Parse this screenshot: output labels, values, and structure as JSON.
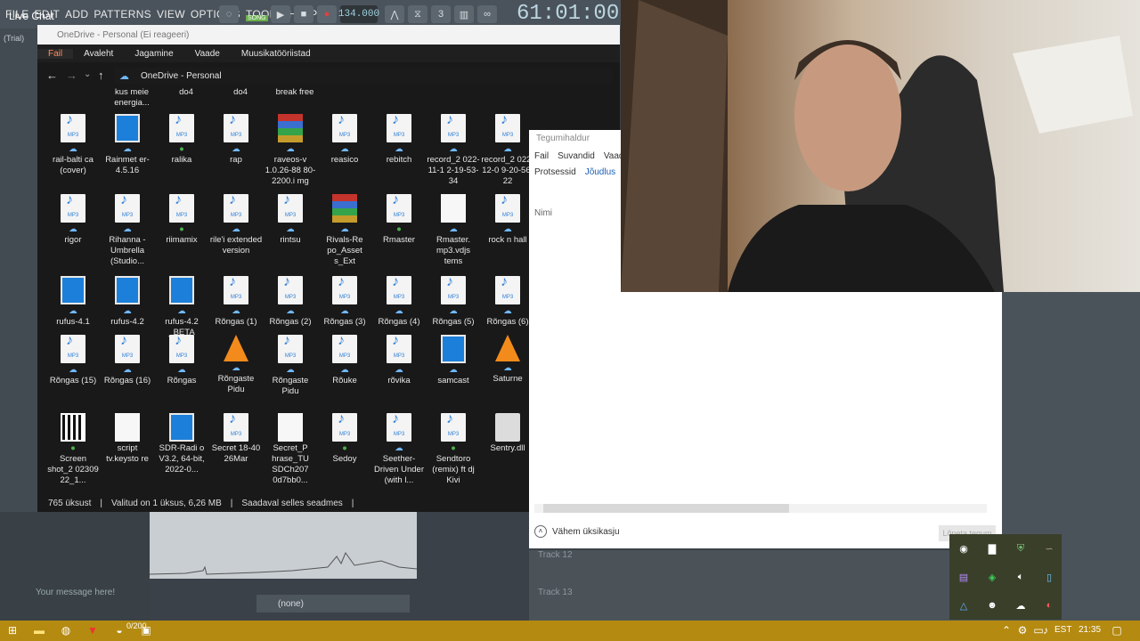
{
  "fl": {
    "menu": [
      "FILE",
      "EDIT",
      "ADD",
      "PATTERNS",
      "VIEW",
      "OPTIONS",
      "TOOLS",
      "HELP"
    ],
    "live_chat": "Live Chat",
    "song_label": "SONG",
    "tempo": "134.000",
    "time": "61:01:00",
    "trial": "(Trial)",
    "none_label": "(none)",
    "chat_placeholder": "Your message here!",
    "chat_count": "0/200",
    "track12": "Track 12",
    "track13": "Track 13"
  },
  "explorer": {
    "title": "OneDrive - Personal (Ei reageeri)",
    "ribbon": [
      "Fail",
      "Avaleht",
      "Jagamine",
      "Vaade",
      "Muusikatööriistad"
    ],
    "path": "OneDrive - Personal",
    "status": {
      "count": "765 üksust",
      "selected": "Valitud on 1 üksus, 6,26 MB",
      "available": "Saadaval selles seadmes"
    },
    "partial_top": [
      "kus meie energia...",
      "do4",
      "do4",
      "break free"
    ],
    "files": [
      {
        "name": "rail-balti ca (cover)",
        "type": "mp3",
        "badge": "cloud"
      },
      {
        "name": "Rainmet er-4.5.16",
        "type": "exe",
        "badge": "cloud"
      },
      {
        "name": "ralika",
        "type": "mp3",
        "badge": "check"
      },
      {
        "name": "rap",
        "type": "mp3",
        "badge": "cloud"
      },
      {
        "name": "raveos-v 1.0.26-88 80-2200.i mg",
        "type": "rar",
        "badge": "cloud"
      },
      {
        "name": "reasico",
        "type": "mp3",
        "badge": "cloud"
      },
      {
        "name": "rebitch",
        "type": "mp3",
        "badge": "cloud"
      },
      {
        "name": "record_2 022-11-1 2-19-53- 34",
        "type": "mp3",
        "badge": "cloud"
      },
      {
        "name": "record_2 022-12-0 9-20-56- 22",
        "type": "mp3",
        "badge": "cloud"
      },
      {
        "name": "rigor",
        "type": "mp3",
        "badge": "cloud"
      },
      {
        "name": "Rihanna - Umbrella (Studio...",
        "type": "mp3",
        "badge": "cloud"
      },
      {
        "name": "riimamix",
        "type": "mp3",
        "badge": "check"
      },
      {
        "name": "rile'i extended version",
        "type": "mp3",
        "badge": "cloud"
      },
      {
        "name": "rintsu",
        "type": "mp3",
        "badge": "cloud"
      },
      {
        "name": "Rivals-Re po_Asset s_Ext",
        "type": "rar",
        "badge": "cloud"
      },
      {
        "name": "Rmaster",
        "type": "mp3",
        "badge": "check"
      },
      {
        "name": "Rmaster. mp3.vdjs tems",
        "type": "doc",
        "badge": "cloud"
      },
      {
        "name": "rock n hall",
        "type": "mp3",
        "badge": "cloud"
      },
      {
        "name": "rufus-4.1",
        "type": "exe",
        "badge": "cloud"
      },
      {
        "name": "rufus-4.2",
        "type": "exe",
        "badge": "cloud"
      },
      {
        "name": "rufus-4.2 _BETA",
        "type": "exe",
        "badge": "cloud"
      },
      {
        "name": "Rõngas (1)",
        "type": "mp3",
        "badge": "cloud"
      },
      {
        "name": "Rõngas (2)",
        "type": "mp3",
        "badge": "cloud"
      },
      {
        "name": "Rõngas (3)",
        "type": "mp3",
        "badge": "cloud"
      },
      {
        "name": "Rõngas (4)",
        "type": "mp3",
        "badge": "cloud"
      },
      {
        "name": "Rõngas (5)",
        "type": "mp3",
        "badge": "cloud"
      },
      {
        "name": "Rõngas (6)",
        "type": "mp3",
        "badge": "cloud"
      },
      {
        "name": "Rõngas (15)",
        "type": "mp3",
        "badge": "cloud"
      },
      {
        "name": "Rõngas (16)",
        "type": "mp3",
        "badge": "cloud"
      },
      {
        "name": "Rõngas",
        "type": "mp3",
        "badge": "cloud"
      },
      {
        "name": "Rõngaste Pidu",
        "type": "vlc",
        "badge": "cloud"
      },
      {
        "name": "Rõngaste Pidu",
        "type": "mp3",
        "badge": "cloud"
      },
      {
        "name": "Rõuke",
        "type": "mp3",
        "badge": "cloud"
      },
      {
        "name": "rõvika",
        "type": "mp3",
        "badge": "cloud"
      },
      {
        "name": "samcast",
        "type": "exe",
        "badge": "cloud"
      },
      {
        "name": "Saturne",
        "type": "vlc",
        "badge": "cloud"
      },
      {
        "name": "Screen shot_2 02309 22_1...",
        "type": "qr",
        "badge": "check"
      },
      {
        "name": "script tv.keysto re",
        "type": "doc",
        "badge": ""
      },
      {
        "name": "SDR-Radi o V3.2, 64-bit, 2022-0...",
        "type": "exe",
        "badge": ""
      },
      {
        "name": "Secret 18-40 26Mar",
        "type": "mp3",
        "badge": ""
      },
      {
        "name": "Secret_P hrase_TU SDCh207 0d7bb0...",
        "type": "doc",
        "badge": ""
      },
      {
        "name": "Sedoy",
        "type": "mp3",
        "badge": "check"
      },
      {
        "name": "Seether- Driven Under (with l...",
        "type": "mp3",
        "badge": "cloud"
      },
      {
        "name": "Sendtoro (remix) ft dj Kivi",
        "type": "mp3",
        "badge": "check"
      },
      {
        "name": "Sentry.dll",
        "type": "gear",
        "badge": ""
      }
    ]
  },
  "taskmgr": {
    "title": "Tegumihaldur",
    "menu": [
      "Fail",
      "Suvandid",
      "Vaade"
    ],
    "tabs": [
      "Protsessid",
      "Jõudlus"
    ],
    "name_col": "Nimi",
    "less_details": "Vähem üksikasju",
    "end_task": "Lõpeta tegum"
  },
  "taskbar": {
    "lang": "EST",
    "time": "21:35"
  },
  "colors": {
    "taskbar": "#b48a10",
    "explorer_bg": "#191919",
    "fail_tab": "#ff8c5a"
  }
}
